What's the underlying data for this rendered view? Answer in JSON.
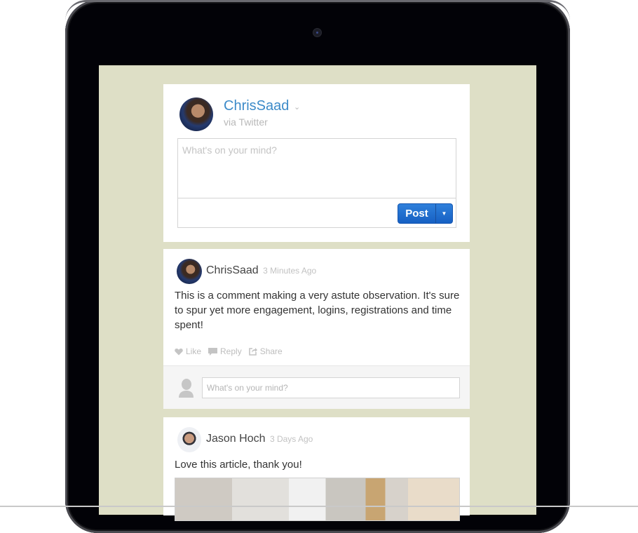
{
  "composer": {
    "author": "ChrisSaad",
    "via": "via Twitter",
    "placeholder": "What's on your mind?",
    "post_label": "Post",
    "brand_color": "#3d8bc9",
    "button_color": "#1f6fd0"
  },
  "comments": [
    {
      "author": "ChrisSaad",
      "time": "3 Minutes Ago",
      "body": "This is a comment making a very astute observation. It's sure to spur yet more engagement, logins, registrations and time spent!",
      "actions": {
        "like": "Like",
        "reply": "Reply",
        "share": "Share"
      },
      "reply_placeholder": "What's on your mind?"
    },
    {
      "author": "Jason Hoch",
      "time": "3 Days Ago",
      "body": "Love this article, thank you!"
    }
  ]
}
